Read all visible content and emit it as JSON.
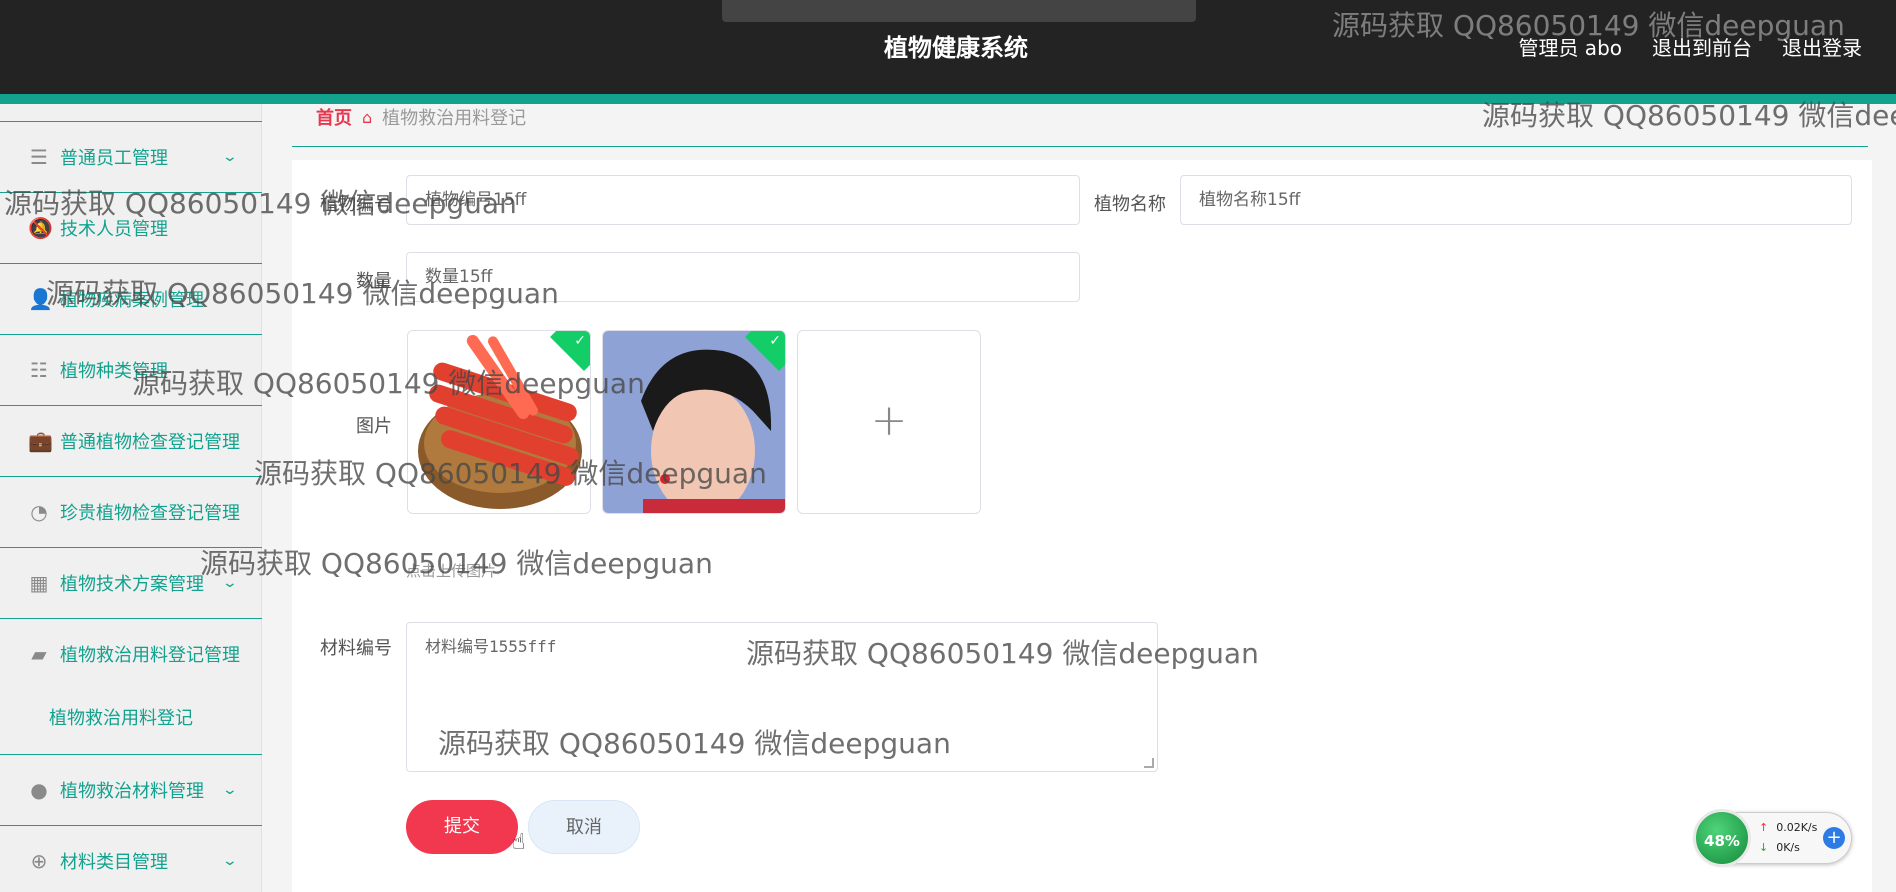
{
  "header": {
    "title": "植物健康系统",
    "admin_label": "管理员 abo",
    "to_frontend": "退出到前台",
    "logout": "退出登录"
  },
  "sidebar": {
    "items": [
      {
        "label": "普通员工管理",
        "icon": "menu-icon"
      },
      {
        "label": "技术人员管理",
        "icon": "bell-icon"
      },
      {
        "label": "植物疾病案例管理",
        "icon": "user-icon"
      },
      {
        "label": "植物种类管理",
        "icon": "list-icon"
      },
      {
        "label": "普通植物检查登记管理",
        "icon": "briefcase-icon"
      },
      {
        "label": "珍贵植物检查登记管理",
        "icon": "gauge-icon"
      },
      {
        "label": "植物技术方案管理",
        "icon": "grid-icon"
      },
      {
        "label": "植物救治用料登记管理",
        "icon": "ticket-icon"
      },
      {
        "label": "植物救治材料管理",
        "icon": "bulb-icon"
      },
      {
        "label": "材料类目管理",
        "icon": "compass-icon"
      }
    ],
    "active_sub": "植物救治用料登记"
  },
  "breadcrumb": {
    "home": "首页",
    "current": "植物救治用料登记"
  },
  "form": {
    "plant_code_label": "植物编号",
    "plant_code_value": "植物编号15ff",
    "plant_name_label": "植物名称",
    "plant_name_value": "植物名称15ff",
    "qty_label": "数量",
    "qty_value": "数量15ff",
    "image_label": "图片",
    "upload_hint": "点击上传图片",
    "material_code_label": "材料编号",
    "material_code_value": "材料编号1555fff",
    "submit": "提交",
    "cancel": "取消"
  },
  "watermark": "源码获取 QQ86050149 微信deepguan",
  "net_monitor": {
    "percent": "48%",
    "up": "0.02K/s",
    "down": "0K/s"
  },
  "colors": {
    "accent": "#12a28e",
    "submit": "#f2384f"
  }
}
